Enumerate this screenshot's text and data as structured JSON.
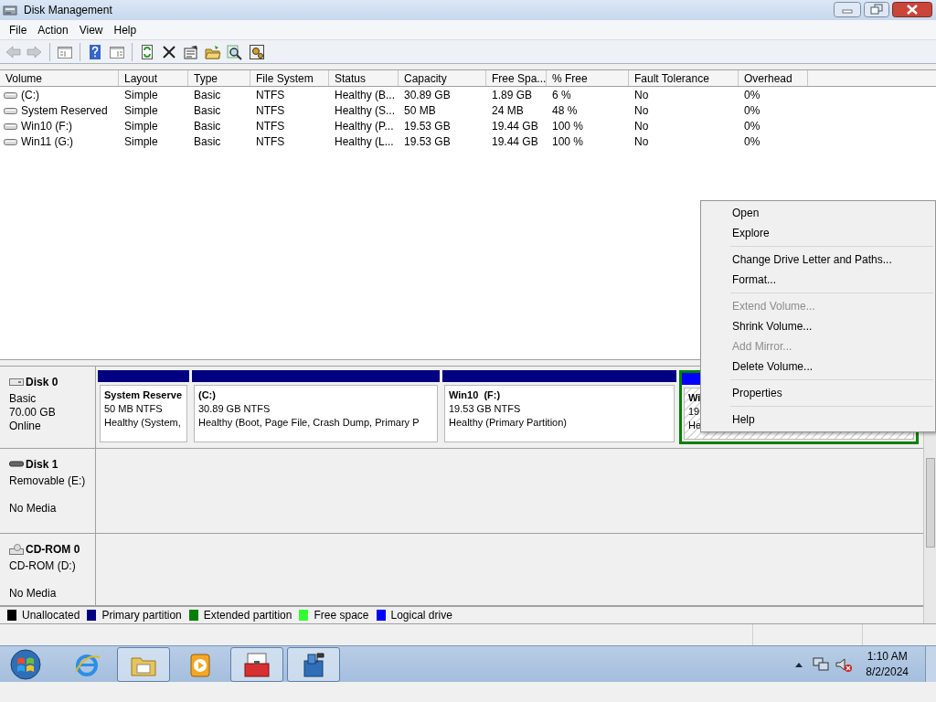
{
  "window": {
    "title": "Disk Management"
  },
  "menu_bar": [
    "File",
    "Action",
    "View",
    "Help"
  ],
  "toolbar": [
    {
      "kind": "back",
      "disabled": true
    },
    {
      "kind": "forward",
      "disabled": true
    },
    {
      "kind": "sep"
    },
    {
      "kind": "tree",
      "disabled": false
    },
    {
      "kind": "sep"
    },
    {
      "kind": "help",
      "disabled": false
    },
    {
      "kind": "pane",
      "disabled": false
    },
    {
      "kind": "sep"
    },
    {
      "kind": "refresh",
      "disabled": false
    },
    {
      "kind": "delete",
      "disabled": false
    },
    {
      "kind": "properties",
      "disabled": false
    },
    {
      "kind": "open",
      "disabled": false
    },
    {
      "kind": "search",
      "disabled": false
    },
    {
      "kind": "settings",
      "disabled": false
    }
  ],
  "table": {
    "columns": [
      "Volume",
      "Layout",
      "Type",
      "File System",
      "Status",
      "Capacity",
      "Free Spa...",
      "% Free",
      "Fault Tolerance",
      "Overhead"
    ],
    "rows": [
      [
        "(C:)",
        "Simple",
        "Basic",
        "NTFS",
        "Healthy (B...",
        "30.89 GB",
        "1.89 GB",
        "6 %",
        "No",
        "0%"
      ],
      [
        "System Reserved",
        "Simple",
        "Basic",
        "NTFS",
        "Healthy (S...",
        "50 MB",
        "24 MB",
        "48 %",
        "No",
        "0%"
      ],
      [
        "Win10 (F:)",
        "Simple",
        "Basic",
        "NTFS",
        "Healthy (P...",
        "19.53 GB",
        "19.44 GB",
        "100 %",
        "No",
        "0%"
      ],
      [
        "Win11 (G:)",
        "Simple",
        "Basic",
        "NTFS",
        "Healthy (L...",
        "19.53 GB",
        "19.44 GB",
        "100 %",
        "No",
        "0%"
      ]
    ]
  },
  "disks": [
    {
      "kind": "disk",
      "name": "Disk 0",
      "lines": [
        "Basic",
        "70.00 GB",
        "Online"
      ],
      "partitions": [
        {
          "kind": "primary",
          "name": "System Reserve",
          "size": "50 MB NTFS",
          "status": "Healthy (System,",
          "selected": false
        },
        {
          "kind": "primary",
          "name": "(C:)",
          "size": "30.89 GB NTFS",
          "status": "Healthy (Boot, Page File, Crash Dump, Primary P",
          "selected": false
        },
        {
          "kind": "primary",
          "name": "Win10  (F:)",
          "size": "19.53 GB NTFS",
          "status": "Healthy (Primary Partition)",
          "selected": false
        },
        {
          "kind": "logical",
          "name": "Wi",
          "size": "19",
          "status": "He",
          "selected": true
        }
      ]
    },
    {
      "kind": "removable",
      "name": "Disk 1",
      "lines": [
        "Removable (E:)"
      ],
      "media": "No Media"
    },
    {
      "kind": "cdrom",
      "name": "CD-ROM 0",
      "lines": [
        "CD-ROM (D:)"
      ],
      "media": "No Media"
    }
  ],
  "legend": [
    {
      "label": "Unallocated",
      "color": "#000000"
    },
    {
      "label": "Primary partition",
      "color": "#000080"
    },
    {
      "label": "Extended partition",
      "color": "#008000"
    },
    {
      "label": "Free space",
      "color": "#33ff33"
    },
    {
      "label": "Logical drive",
      "color": "#0000ff"
    }
  ],
  "context_menu": [
    [
      {
        "label": "Open",
        "disabled": false
      },
      {
        "label": "Explore",
        "disabled": false
      }
    ],
    [
      {
        "label": "Change Drive Letter and Paths...",
        "disabled": false
      },
      {
        "label": "Format...",
        "disabled": false
      }
    ],
    [
      {
        "label": "Extend Volume...",
        "disabled": true
      },
      {
        "label": "Shrink Volume...",
        "disabled": false
      },
      {
        "label": "Add Mirror...",
        "disabled": true
      },
      {
        "label": "Delete Volume...",
        "disabled": false
      }
    ],
    [
      {
        "label": "Properties",
        "disabled": false
      }
    ],
    [
      {
        "label": "Help",
        "disabled": false
      }
    ]
  ],
  "taskbar": {
    "items": [
      {
        "kind": "browser",
        "running": false
      },
      {
        "kind": "folder",
        "running": true
      },
      {
        "kind": "media",
        "running": false
      },
      {
        "kind": "toolbox",
        "running": true
      },
      {
        "kind": "server",
        "running": true
      }
    ],
    "time": "1:10 AM",
    "date": "8/2/2024"
  }
}
